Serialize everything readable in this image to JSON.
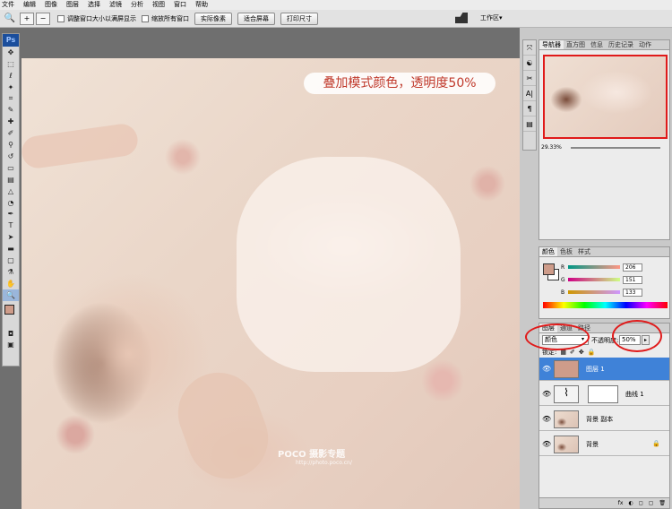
{
  "menu": [
    "文件",
    "编辑",
    "图像",
    "图层",
    "选择",
    "滤镜",
    "分析",
    "视图",
    "窗口",
    "帮助"
  ],
  "options": {
    "tool_glyph": "🔍",
    "zoom_in": "+",
    "zoom_out": "−",
    "resize_label": "调整窗口大小以满屏显示",
    "zoom_all_label": "缩放所有窗口",
    "actual_pixels": "实际像素",
    "fit_screen": "适合屏幕",
    "print_size": "打印尺寸",
    "workspace": "工作区",
    "workspace_arrow": "▾"
  },
  "toolbox": {
    "badge": "Ps",
    "tools": [
      {
        "name": "move-tool",
        "glyph": "✥"
      },
      {
        "name": "marquee-tool",
        "glyph": "⬚"
      },
      {
        "name": "lasso-tool",
        "glyph": "ℓ"
      },
      {
        "name": "magic-wand-tool",
        "glyph": "✦"
      },
      {
        "name": "crop-tool",
        "glyph": "⌗"
      },
      {
        "name": "slice-tool",
        "glyph": "✎"
      },
      {
        "name": "healing-tool",
        "glyph": "✚"
      },
      {
        "name": "brush-tool",
        "glyph": "✐"
      },
      {
        "name": "stamp-tool",
        "glyph": "⚲"
      },
      {
        "name": "history-brush-tool",
        "glyph": "↺"
      },
      {
        "name": "eraser-tool",
        "glyph": "▭"
      },
      {
        "name": "gradient-tool",
        "glyph": "▤"
      },
      {
        "name": "blur-tool",
        "glyph": "△"
      },
      {
        "name": "dodge-tool",
        "glyph": "◔"
      },
      {
        "name": "pen-tool",
        "glyph": "✒"
      },
      {
        "name": "type-tool",
        "glyph": "T"
      },
      {
        "name": "path-selection-tool",
        "glyph": "➤"
      },
      {
        "name": "shape-tool",
        "glyph": "▬"
      },
      {
        "name": "notes-tool",
        "glyph": "▢"
      },
      {
        "name": "eyedropper-tool",
        "glyph": "⚗"
      },
      {
        "name": "hand-tool",
        "glyph": "✋"
      },
      {
        "name": "zoom-tool",
        "glyph": "🔍",
        "active": true
      }
    ],
    "mode_glyph": "◘",
    "screen_glyph": "▣"
  },
  "canvas": {
    "caption": "叠加模式颜色，透明度50%",
    "watermark": "POCO 摄影专题",
    "watermark_url": "http://photo.poco.cn/"
  },
  "iconstrip": [
    "⤧",
    "☯",
    "✂",
    "A|",
    "¶",
    "▤"
  ],
  "navigator": {
    "tabs": [
      "导航器",
      "直方图",
      "信息",
      "历史记录",
      "动作"
    ],
    "zoom": "29.33%"
  },
  "color": {
    "tabs": [
      "颜色",
      "色板",
      "样式"
    ],
    "fg_color": "#ce9c8a",
    "channels": [
      {
        "label": "R",
        "value": "206"
      },
      {
        "label": "G",
        "value": "151"
      },
      {
        "label": "B",
        "value": "133"
      }
    ]
  },
  "layers": {
    "tabs": [
      "图层",
      "通道",
      "路径"
    ],
    "blend_mode": "颜色",
    "opacity_label": "不透明度:",
    "opacity_value": "50%",
    "lock_label": "锁定:",
    "items": [
      {
        "name": "图层 1",
        "selected": true,
        "thumb_color": "#ce9c8a"
      },
      {
        "name": "曲线 1",
        "selected": false,
        "adjustment": true
      },
      {
        "name": "背景 副本",
        "selected": false
      },
      {
        "name": "背景",
        "selected": false,
        "locked": true
      }
    ],
    "bottom_icons": [
      "fx",
      "◐",
      "◻",
      "▢",
      "🗑"
    ]
  },
  "colors": {
    "annotation_red": "#e01a1a",
    "selection_blue": "#3f82d8"
  }
}
